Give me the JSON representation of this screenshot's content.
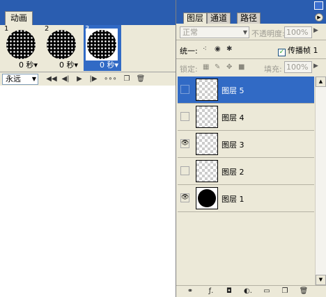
{
  "animation": {
    "tab_label": "动画",
    "frames": [
      {
        "number": "1",
        "delay": "0 秒▾",
        "selected": false
      },
      {
        "number": "2",
        "delay": "0 秒▾",
        "selected": false
      },
      {
        "number": "3",
        "delay": "0 秒▾",
        "selected": true
      }
    ],
    "loop_value": "永远",
    "toolbar_icons": [
      "first-frame-icon",
      "previous-frame-icon",
      "play-icon",
      "next-frame-icon",
      "tween-icon",
      "new-frame-icon",
      "delete-frame-icon"
    ]
  },
  "layers_panel": {
    "tabs": [
      "图层",
      "通道",
      "路径"
    ],
    "active_tab": "图层",
    "blend_mode": "正常",
    "opacity_label": "不透明度:",
    "opacity_value": "100%",
    "unify_label": "统一:",
    "propagate_label": "传播帧 1",
    "propagate_checked": true,
    "lock_label": "锁定:",
    "fill_label": "填充:",
    "fill_value": "100%",
    "layers": [
      {
        "name": "图层 5",
        "visible": false,
        "selected": true,
        "filled": false
      },
      {
        "name": "图层 4",
        "visible": false,
        "selected": false,
        "filled": false
      },
      {
        "name": "图层 3",
        "visible": true,
        "selected": false,
        "filled": false
      },
      {
        "name": "图层 2",
        "visible": false,
        "selected": false,
        "filled": false
      },
      {
        "name": "图层 1",
        "visible": true,
        "selected": false,
        "filled": true
      }
    ],
    "footer_icons": [
      "link-icon",
      "layer-style-icon",
      "mask-icon",
      "adjustment-icon",
      "folder-icon",
      "new-layer-icon",
      "trash-icon"
    ]
  },
  "colors": {
    "title_blue": "#2a5db0",
    "selection_blue": "#316ac5",
    "panel_bg": "#ece9d8"
  }
}
